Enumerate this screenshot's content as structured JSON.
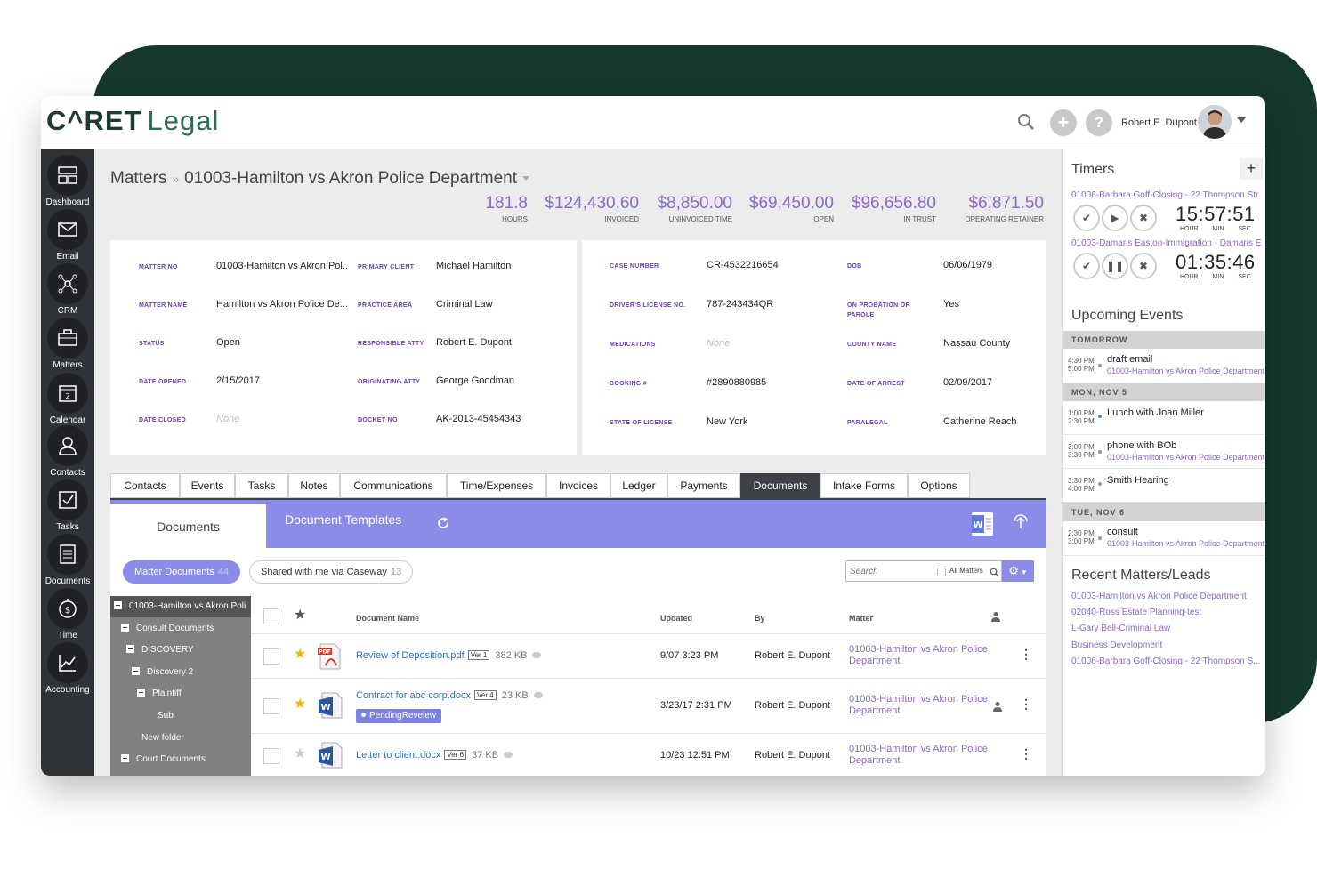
{
  "app": {
    "logo_bold": "C^RET",
    "logo_light": "Legal",
    "user_name": "Robert E. Dupont"
  },
  "icons": {
    "search": "search-icon",
    "add": "plus-icon",
    "help": "question-icon"
  },
  "sidebar": {
    "items": [
      {
        "label": "Dashboard",
        "icon": "dashboard-icon"
      },
      {
        "label": "Email",
        "icon": "envelope-icon"
      },
      {
        "label": "CRM",
        "icon": "network-icon"
      },
      {
        "label": "Matters",
        "icon": "briefcase-icon"
      },
      {
        "label": "Calendar",
        "icon": "calendar-icon"
      },
      {
        "label": "Contacts",
        "icon": "person-icon"
      },
      {
        "label": "Tasks",
        "icon": "checkbox-icon"
      },
      {
        "label": "Documents",
        "icon": "document-icon"
      },
      {
        "label": "Time",
        "icon": "stopwatch-icon"
      },
      {
        "label": "Accounting",
        "icon": "chart-icon"
      }
    ]
  },
  "breadcrumb": {
    "root": "Matters",
    "sep": "»",
    "current": "01003-Hamilton vs Akron Police Department"
  },
  "stats": [
    {
      "value": "181.8",
      "label": "HOURS"
    },
    {
      "value": "$124,430.60",
      "label": "INVOICED"
    },
    {
      "value": "$8,850.00",
      "label": "UNINVOICED TIME"
    },
    {
      "value": "$69,450.00",
      "label": "OPEN"
    },
    {
      "value": "$96,656.80",
      "label": "IN TRUST"
    },
    {
      "value": "$6,871.50",
      "label": "OPERATING RETAINER"
    }
  ],
  "matter_fields": {
    "matter_no": {
      "label": "MATTER NO",
      "value": "01003-Hamilton vs Akron Pol..."
    },
    "matter_name": {
      "label": "MATTER NAME",
      "value": "Hamilton vs Akron Police De..."
    },
    "status": {
      "label": "STATUS",
      "value": "Open"
    },
    "date_opened": {
      "label": "DATE OPENED",
      "value": "2/15/2017"
    },
    "date_closed": {
      "label": "DATE CLOSED",
      "value": "None"
    },
    "primary_client": {
      "label": "PRIMARY CLIENT",
      "value": "Michael Hamilton"
    },
    "practice_area": {
      "label": "PRACTICE AREA",
      "value": "Criminal Law"
    },
    "responsible_atty": {
      "label": "RESPONSIBLE ATTY",
      "value": "Robert E. Dupont"
    },
    "originating_atty": {
      "label": "ORIGINATING ATTY",
      "value": "George Goodman"
    },
    "docket_no": {
      "label": "DOCKET NO",
      "value": "AK-2013-45454343"
    }
  },
  "case_fields": {
    "case_number": {
      "label": "CASE NUMBER",
      "value": "CR-4532216654"
    },
    "drivers_license": {
      "label": "DRIVER'S LICENSE NO.",
      "value": "787-243434QR"
    },
    "medications": {
      "label": "MEDICATIONS",
      "value": "None"
    },
    "booking": {
      "label": "BOOKING #",
      "value": "#2890880985"
    },
    "state_of_license": {
      "label": "STATE OF LICENSE",
      "value": "New York"
    },
    "dob": {
      "label": "DOB",
      "value": "06/06/1979"
    },
    "probation_l1": "ON PROBATION OR",
    "probation_l2": "PAROLE",
    "probation_value": "Yes",
    "county": {
      "label": "COUNTY NAME",
      "value": "Nassau County"
    },
    "date_of_arrest": {
      "label": "DATE OF ARREST",
      "value": "02/09/2017"
    },
    "paralegal": {
      "label": "PARALEGAL",
      "value": "Catherine Reach"
    }
  },
  "tabs": [
    "Contacts",
    "Events",
    "Tasks",
    "Notes",
    "Communications",
    "Time/Expenses",
    "Invoices",
    "Ledger",
    "Payments",
    "Documents",
    "Intake Forms",
    "Options"
  ],
  "active_tab": "Documents",
  "docs": {
    "tab_documents": "Documents",
    "tab_templates": "Document Templates",
    "pill_matter": "Matter Documents",
    "pill_matter_count": "44",
    "pill_shared": "Shared with me via Caseway",
    "pill_shared_count": "13",
    "search_placeholder": "Search",
    "all_matters": "All Matters",
    "tree": [
      "01003-Hamilton vs Akron Poli",
      "Consult Documents",
      "DISCOVERY",
      "Discovery 2",
      "Plaintiff",
      "Sub",
      "New folder",
      "Court Documents"
    ],
    "columns": {
      "name": "Document Name",
      "updated": "Updated",
      "by": "By",
      "matter": "Matter"
    },
    "rows": [
      {
        "name": "Review of Deposition.pdf",
        "ver": "Ver 1",
        "size": "382 KB",
        "updated": "9/07 3:23 PM",
        "by": "Robert E. Dupont",
        "matter": "01003-Hamilton vs Akron Police Department",
        "badge": "",
        "type": "pdf-icon",
        "starred": true
      },
      {
        "name": "Contract for abc corp.docx",
        "ver": "Ver 4",
        "size": "23 KB",
        "updated": "3/23/17 2:31 PM",
        "by": "Robert E. Dupont",
        "matter": "01003-Hamilton vs Akron Police Department",
        "badge": "PendingReveiew",
        "type": "word-icon",
        "starred": true
      },
      {
        "name": "Letter to client.docx",
        "ver": "Ver 6",
        "size": "37 KB",
        "updated": "10/23 12:51 PM",
        "by": "Robert E. Dupont",
        "matter": "01003-Hamilton vs Akron Police Department",
        "badge": "",
        "type": "word-icon",
        "starred": false
      }
    ]
  },
  "timers": {
    "title": "Timers",
    "items": [
      {
        "name": "01006-Barbara Goff-Closing - 22 Thompson Str",
        "time": "15:57:51",
        "state": "play"
      },
      {
        "name": "01003-Damaris Easton-Immigration - Damaris E",
        "time": "01:35:46",
        "state": "pause"
      }
    ],
    "units": "HOUR MIN SEC"
  },
  "upcoming": {
    "title": "Upcoming Events",
    "groups": [
      {
        "header": "TOMORROW",
        "events": [
          {
            "start": "4:30 PM",
            "end": "5:00 PM",
            "title": "draft email",
            "sub": "01003-Hamilton vs Akron Police Department"
          }
        ]
      },
      {
        "header": "MON, NOV 5",
        "events": [
          {
            "start": "1:00 PM",
            "end": "2:30 PM",
            "title": "Lunch with Joan Miller",
            "sub": ""
          },
          {
            "start": "3:00 PM",
            "end": "3:30 PM",
            "title": "phone with BOb",
            "sub": "01003-Hamilton vs Akron Police Department"
          },
          {
            "start": "3:30 PM",
            "end": "4:00 PM",
            "title": "Smith Hearing",
            "sub": ""
          }
        ]
      },
      {
        "header": "TUE, NOV 6",
        "events": [
          {
            "start": "2:30 PM",
            "end": "3:00 PM",
            "title": "consult",
            "sub": "01003-Hamilton vs Akron Police Department"
          }
        ]
      }
    ]
  },
  "recent": {
    "title": "Recent Matters/Leads",
    "items": [
      "01003-Hamilton vs Akron Police Department",
      "02040-Ross Estate Planning-test",
      "L-Gary Bell-Criminal Law",
      "Business Development",
      "01006-Barbara Goff-Closing - 22 Thompson S..."
    ]
  },
  "colors": {
    "accent": "#8b68c9",
    "brand_dark": "#15372c",
    "doc_header": "#8b8ce7",
    "sidebar": "#2f3237"
  }
}
